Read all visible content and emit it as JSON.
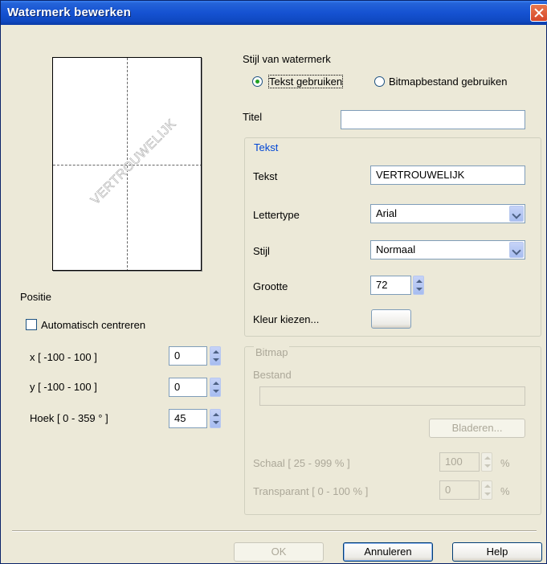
{
  "window": {
    "title": "Watermerk bewerken"
  },
  "preview": {
    "watermark_text": "VERTROUWELIJK"
  },
  "position": {
    "section_label": "Positie",
    "auto_center_label": "Automatisch centreren",
    "auto_center_checked": false,
    "x_label": "x [ -100 - 100 ]",
    "x_value": "0",
    "y_label": "y [ -100 - 100 ]",
    "y_value": "0",
    "angle_label": "Hoek [ 0 - 359 ° ]",
    "angle_value": "45"
  },
  "style": {
    "section_label": "Stijl van watermerk",
    "use_text_label": "Tekst gebruiken",
    "use_bitmap_label": "Bitmapbestand gebruiken",
    "selected": "text"
  },
  "title_field": {
    "label": "Titel",
    "value": ""
  },
  "text_group": {
    "legend": "Tekst",
    "text_label": "Tekst",
    "text_value": "VERTROUWELIJK",
    "font_label": "Lettertype",
    "font_value": "Arial",
    "style_label": "Stijl",
    "style_value": "Normaal",
    "size_label": "Grootte",
    "size_value": "72",
    "color_label": "Kleur kiezen...",
    "color_swatch": "#ece9d8"
  },
  "bitmap_group": {
    "legend": "Bitmap",
    "file_label": "Bestand",
    "file_value": "",
    "browse_label": "Bladeren...",
    "scale_label": "Schaal [ 25 - 999 % ]",
    "scale_value": "100",
    "scale_unit": "%",
    "transparency_label": "Transparant [ 0 - 100 % ]",
    "transparency_value": "0",
    "transparency_unit": "%"
  },
  "buttons": {
    "ok": "OK",
    "cancel": "Annuleren",
    "help": "Help"
  }
}
